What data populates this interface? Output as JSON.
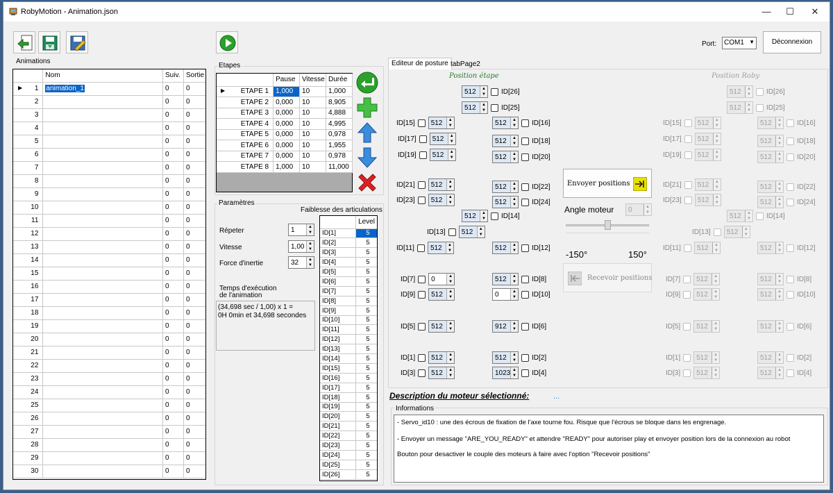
{
  "window": {
    "title": "RobyMotion - Animation.json",
    "minimize": "—",
    "maximize": "☐",
    "close": "✕"
  },
  "toolbar": {
    "port_label": "Port:",
    "port_value": "COM1",
    "disconnect_label": "Déconnexion"
  },
  "animations": {
    "group_title": "Animations",
    "columns": [
      "Nom",
      "Suiv.",
      "Sortie"
    ],
    "rows": [
      {
        "n": "1",
        "name": "animation_1",
        "suiv": "0",
        "sortie": "0"
      },
      {
        "n": "2",
        "name": "",
        "suiv": "0",
        "sortie": "0"
      },
      {
        "n": "3",
        "name": "",
        "suiv": "0",
        "sortie": "0"
      },
      {
        "n": "4",
        "name": "",
        "suiv": "0",
        "sortie": "0"
      },
      {
        "n": "5",
        "name": "",
        "suiv": "0",
        "sortie": "0"
      },
      {
        "n": "6",
        "name": "",
        "suiv": "0",
        "sortie": "0"
      },
      {
        "n": "7",
        "name": "",
        "suiv": "0",
        "sortie": "0"
      },
      {
        "n": "8",
        "name": "",
        "suiv": "0",
        "sortie": "0"
      },
      {
        "n": "9",
        "name": "",
        "suiv": "0",
        "sortie": "0"
      },
      {
        "n": "10",
        "name": "",
        "suiv": "0",
        "sortie": "0"
      },
      {
        "n": "11",
        "name": "",
        "suiv": "0",
        "sortie": "0"
      },
      {
        "n": "12",
        "name": "",
        "suiv": "0",
        "sortie": "0"
      },
      {
        "n": "13",
        "name": "",
        "suiv": "0",
        "sortie": "0"
      },
      {
        "n": "14",
        "name": "",
        "suiv": "0",
        "sortie": "0"
      },
      {
        "n": "15",
        "name": "",
        "suiv": "0",
        "sortie": "0"
      },
      {
        "n": "16",
        "name": "",
        "suiv": "0",
        "sortie": "0"
      },
      {
        "n": "17",
        "name": "",
        "suiv": "0",
        "sortie": "0"
      },
      {
        "n": "18",
        "name": "",
        "suiv": "0",
        "sortie": "0"
      },
      {
        "n": "19",
        "name": "",
        "suiv": "0",
        "sortie": "0"
      },
      {
        "n": "20",
        "name": "",
        "suiv": "0",
        "sortie": "0"
      },
      {
        "n": "21",
        "name": "",
        "suiv": "0",
        "sortie": "0"
      },
      {
        "n": "22",
        "name": "",
        "suiv": "0",
        "sortie": "0"
      },
      {
        "n": "23",
        "name": "",
        "suiv": "0",
        "sortie": "0"
      },
      {
        "n": "24",
        "name": "",
        "suiv": "0",
        "sortie": "0"
      },
      {
        "n": "25",
        "name": "",
        "suiv": "0",
        "sortie": "0"
      },
      {
        "n": "26",
        "name": "",
        "suiv": "0",
        "sortie": "0"
      },
      {
        "n": "27",
        "name": "",
        "suiv": "0",
        "sortie": "0"
      },
      {
        "n": "28",
        "name": "",
        "suiv": "0",
        "sortie": "0"
      },
      {
        "n": "29",
        "name": "",
        "suiv": "0",
        "sortie": "0"
      },
      {
        "n": "30",
        "name": "",
        "suiv": "0",
        "sortie": "0"
      }
    ]
  },
  "etapes": {
    "group_title": "Etapes",
    "columns": [
      "Pause",
      "Vitesse",
      "Durée"
    ],
    "rows": [
      {
        "name": "ETAPE 1",
        "pause": "1,000",
        "vitesse": "10",
        "duree": "1,000"
      },
      {
        "name": "ETAPE 2",
        "pause": "0,000",
        "vitesse": "10",
        "duree": "8,905"
      },
      {
        "name": "ETAPE 3",
        "pause": "0,000",
        "vitesse": "10",
        "duree": "4,888"
      },
      {
        "name": "ETAPE 4",
        "pause": "0,000",
        "vitesse": "10",
        "duree": "4,995"
      },
      {
        "name": "ETAPE 5",
        "pause": "0,000",
        "vitesse": "10",
        "duree": "0,978"
      },
      {
        "name": "ETAPE 6",
        "pause": "0,000",
        "vitesse": "10",
        "duree": "1,955"
      },
      {
        "name": "ETAPE 7",
        "pause": "0,000",
        "vitesse": "10",
        "duree": "0,978"
      },
      {
        "name": "ETAPE 8",
        "pause": "1,000",
        "vitesse": "10",
        "duree": "11,000"
      }
    ]
  },
  "parametres": {
    "group_title": "Paramètres",
    "repeter_label": "Répeter",
    "repeter_value": "1",
    "vitesse_label": "Vitesse",
    "vitesse_value": "1,00",
    "inertie_label": "Force d'inertie",
    "inertie_value": "32",
    "temps_label_1": "Temps d'exécution",
    "temps_label_2": "de l'animation",
    "temps_line_1": "(34,698 sec / 1,00) x 1 =",
    "temps_line_2": "0H 0min et 34,698 secondes",
    "faiblesse_title": "Faiblesse des articulations",
    "level_header": "Level",
    "levels": [
      {
        "id": "ID[1]",
        "v": "5"
      },
      {
        "id": "ID[2]",
        "v": "5"
      },
      {
        "id": "ID[3]",
        "v": "5"
      },
      {
        "id": "ID[4]",
        "v": "5"
      },
      {
        "id": "ID[5]",
        "v": "5"
      },
      {
        "id": "ID[6]",
        "v": "5"
      },
      {
        "id": "ID[7]",
        "v": "5"
      },
      {
        "id": "ID[8]",
        "v": "5"
      },
      {
        "id": "ID[9]",
        "v": "5"
      },
      {
        "id": "ID[10]",
        "v": "5"
      },
      {
        "id": "ID[11]",
        "v": "5"
      },
      {
        "id": "ID[12]",
        "v": "5"
      },
      {
        "id": "ID[13]",
        "v": "5"
      },
      {
        "id": "ID[14]",
        "v": "5"
      },
      {
        "id": "ID[15]",
        "v": "5"
      },
      {
        "id": "ID[16]",
        "v": "5"
      },
      {
        "id": "ID[17]",
        "v": "5"
      },
      {
        "id": "ID[18]",
        "v": "5"
      },
      {
        "id": "ID[19]",
        "v": "5"
      },
      {
        "id": "ID[20]",
        "v": "5"
      },
      {
        "id": "ID[21]",
        "v": "5"
      },
      {
        "id": "ID[22]",
        "v": "5"
      },
      {
        "id": "ID[23]",
        "v": "5"
      },
      {
        "id": "ID[24]",
        "v": "5"
      },
      {
        "id": "ID[25]",
        "v": "5"
      },
      {
        "id": "ID[26]",
        "v": "5"
      }
    ]
  },
  "tabs": {
    "tab1": "Editeur de posture",
    "tab2": "tabPage2"
  },
  "posture": {
    "position_etape_title": "Position étape",
    "position_roby_title": "Position Roby",
    "envoyer_label": "Envoyer positions",
    "angle_label": "Angle moteur",
    "angle_value": "0",
    "slider_level": 0.5,
    "angle_min": "-150°",
    "angle_max": "150°",
    "recevoir_label": "Recevoir positions",
    "etape": {
      "ID26": "512",
      "ID25": "512",
      "ID15": "512",
      "ID16": "512",
      "ID17": "512",
      "ID18": "512",
      "ID19": "512",
      "ID20": "512",
      "ID21": "512",
      "ID22": "512",
      "ID23": "512",
      "ID24": "512",
      "ID14": "512",
      "ID13": "512",
      "ID11": "512",
      "ID12": "512",
      "ID7": "0",
      "ID8": "512",
      "ID9": "512",
      "ID10": "0",
      "ID5": "512",
      "ID6": "912",
      "ID1": "512",
      "ID2": "512",
      "ID3": "512",
      "ID4": "1023"
    },
    "roby": {
      "ID26": "512",
      "ID25": "512",
      "ID15": "512",
      "ID16": "512",
      "ID17": "512",
      "ID18": "512",
      "ID19": "512",
      "ID20": "512",
      "ID21": "512",
      "ID22": "512",
      "ID23": "512",
      "ID24": "512",
      "ID14": "512",
      "ID13": "512",
      "ID11": "512",
      "ID12": "512",
      "ID7": "512",
      "ID8": "512",
      "ID9": "512",
      "ID10": "512",
      "ID5": "512",
      "ID6": "512",
      "ID1": "512",
      "ID2": "512",
      "ID3": "512",
      "ID4": "512"
    },
    "labels": {
      "ID1": "ID[1]",
      "ID2": "ID[2]",
      "ID3": "ID[3]",
      "ID4": "ID[4]",
      "ID5": "ID[5]",
      "ID6": "ID[6]",
      "ID7": "ID[7]",
      "ID8": "ID[8]",
      "ID9": "ID[9]",
      "ID10": "ID[10]",
      "ID11": "ID[11]",
      "ID12": "ID[12]",
      "ID13": "ID[13]",
      "ID14": "ID[14]",
      "ID15": "ID[15]",
      "ID16": "ID[16]",
      "ID17": "ID[17]",
      "ID18": "ID[18]",
      "ID19": "ID[19]",
      "ID20": "ID[20]",
      "ID21": "ID[21]",
      "ID22": "ID[22]",
      "ID23": "ID[23]",
      "ID24": "ID[24]",
      "ID25": "ID[25]",
      "ID26": "ID[26]"
    }
  },
  "description": {
    "title": "Description du moteur sélectionné:",
    "value": "..."
  },
  "informations": {
    "group_title": "Informations",
    "lines": [
      "- Servo_id10 : une des écrous de fixation de l'axe tourne fou. Risque que l'écrous se bloque dans les engrenage.",
      "- Envoyer un message \"ARE_YOU_READY\" et attendre \"READY\" pour autoriser play et envoyer position lors de la connexion au robot",
      "Bouton pour desactiver le couple des moteurs à faire avec l'option \"Recevoir positions\""
    ]
  },
  "colors": {
    "accent": "#0a64c8",
    "play": "#2ca02c",
    "yellow": "#e8e000",
    "green_title": "#2a7a2a"
  }
}
